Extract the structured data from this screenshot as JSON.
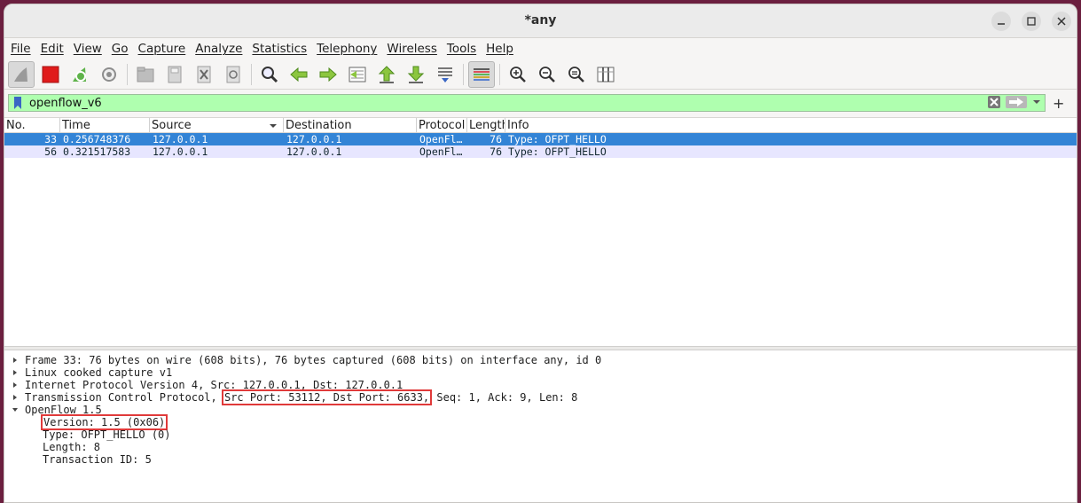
{
  "window": {
    "title": "*any"
  },
  "menu": [
    "File",
    "Edit",
    "View",
    "Go",
    "Capture",
    "Analyze",
    "Statistics",
    "Telephony",
    "Wireless",
    "Tools",
    "Help"
  ],
  "filter": {
    "value": "openflow_v6"
  },
  "columns": [
    "No.",
    "Time",
    "Source",
    "Destination",
    "Protocol",
    "Length",
    "Info"
  ],
  "packets": [
    {
      "no": "33",
      "time": "0.256748376",
      "source": "127.0.0.1",
      "destination": "127.0.0.1",
      "protocol": "OpenFl…",
      "length": "76",
      "info": "Type: OFPT_HELLO"
    },
    {
      "no": "56",
      "time": "0.321517583",
      "source": "127.0.0.1",
      "destination": "127.0.0.1",
      "protocol": "OpenFl…",
      "length": "76",
      "info": "Type: OFPT_HELLO"
    }
  ],
  "details": {
    "frame": "Frame 33: 76 bytes on wire (608 bits), 76 bytes captured (608 bits) on interface any, id 0",
    "sll": "Linux cooked capture v1",
    "ip": "Internet Protocol Version 4, Src: 127.0.0.1, Dst: 127.0.0.1",
    "tcp_prefix": "Transmission Control Protocol, ",
    "tcp_ports": "Src Port: 53112, Dst Port: 6633,",
    "tcp_suffix": " Seq: 1, Ack: 9, Len: 8",
    "openflow": "OpenFlow 1.5",
    "version": "Version: 1.5 (0x06)",
    "type": "Type: OFPT_HELLO (0)",
    "length": "Length: 8",
    "xid": "Transaction ID: 5"
  },
  "colors": {
    "selected_row": "#3384d6",
    "alt_row": "#e7e6ff",
    "filter_bg": "#afffaf",
    "highlight_box": "#e03a3a"
  }
}
